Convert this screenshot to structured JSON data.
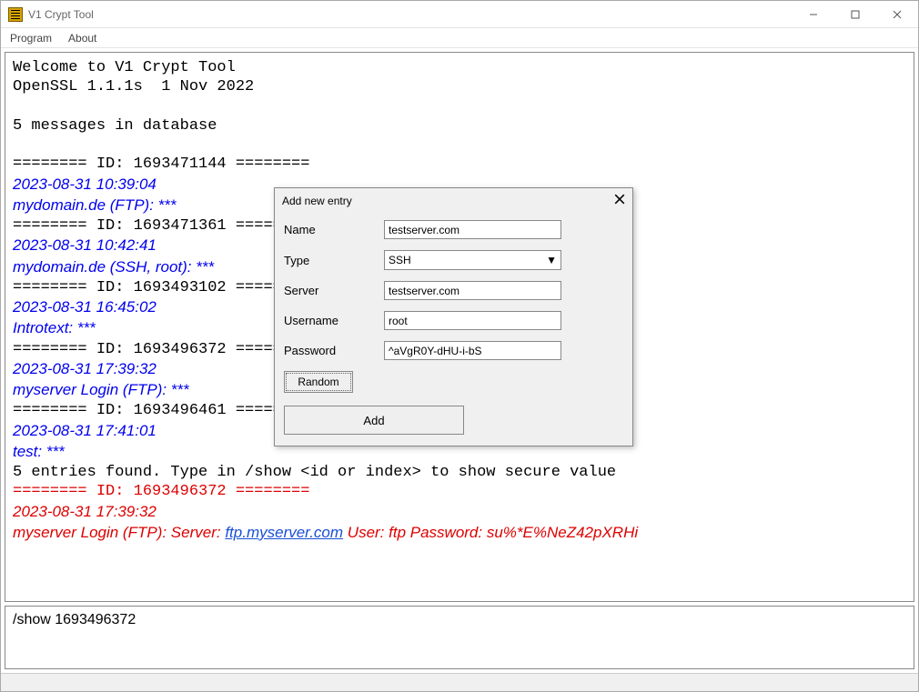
{
  "window": {
    "title": "V1 Crypt Tool"
  },
  "menu": {
    "program": "Program",
    "about": "About"
  },
  "log": {
    "welcome": "Welcome to V1 Crypt Tool",
    "openssl": "OpenSSL 1.1.1s  1 Nov 2022",
    "msgcount": "5 messages in database",
    "sep1": "======== ID: 1693471144 ========",
    "e1_ts": "2023-08-31 10:39:04",
    "e1_name": "mydomain.de (FTP): ***",
    "sep2": "======== ID: 1693471361 ========",
    "e2_ts": "2023-08-31 10:42:41",
    "e2_name": "mydomain.de (SSH, root): ***",
    "sep3": "======== ID: 1693493102 ========",
    "e3_ts": "2023-08-31 16:45:02",
    "e3_name": "Introtext: ***",
    "sep4": "======== ID: 1693496372 ========",
    "e4_ts": "2023-08-31 17:39:32",
    "e4_name": "myserver Login (FTP): ***",
    "sep5": "======== ID: 1693496461 ========",
    "e5_ts": "2023-08-31 17:41:01",
    "e5_name": "test: ***",
    "found": "5 entries found. Type in /show <id or index> to show secure value",
    "sep_show": "======== ID: 1693496372 ========",
    "show_ts": "2023-08-31 17:39:32",
    "show_prefix": "myserver Login (FTP): Server: ",
    "show_link": "ftp.myserver.com",
    "show_suffix": " User: ftp Password: su%*E%NeZ42pXRHi"
  },
  "input": {
    "value": "/show 1693496372"
  },
  "dialog": {
    "title": "Add new entry",
    "labels": {
      "name": "Name",
      "type": "Type",
      "server": "Server",
      "username": "Username",
      "password": "Password"
    },
    "values": {
      "name": "testserver.com",
      "type": "SSH",
      "server": "testserver.com",
      "username": "root",
      "password": "^aVgR0Y-dHU-i-bS"
    },
    "buttons": {
      "random": "Random",
      "add": "Add"
    }
  }
}
